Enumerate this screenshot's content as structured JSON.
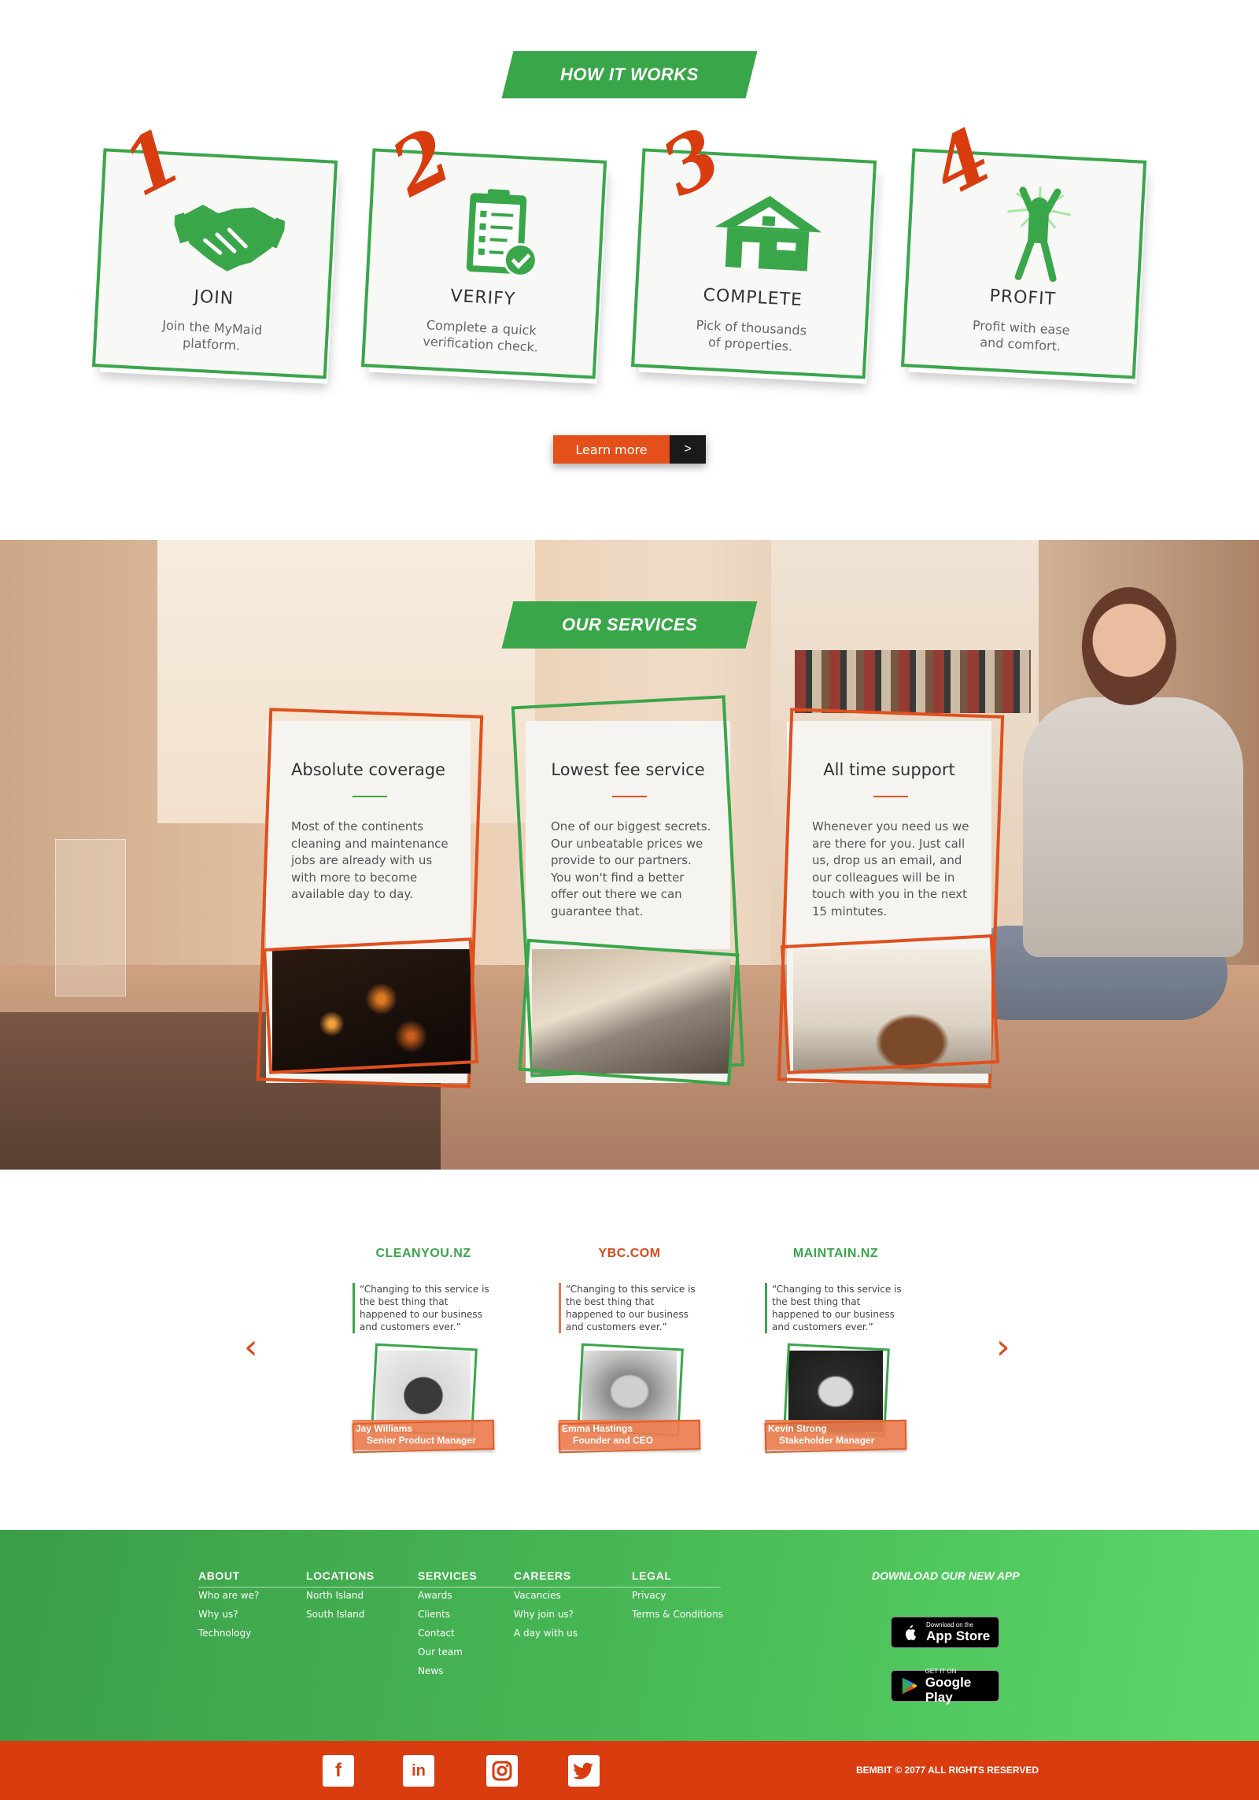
{
  "how": {
    "tag": "HOW IT WORKS",
    "steps": [
      {
        "num": "1",
        "title": "JOIN",
        "desc_line1": "Join the MyMaid",
        "desc_line2": "platform.",
        "icon": "handshake-icon"
      },
      {
        "num": "2",
        "title": "VERIFY",
        "desc_line1": "Complete a quick",
        "desc_line2": "verification check.",
        "icon": "clipboard-check-icon"
      },
      {
        "num": "3",
        "title": "COMPLETE",
        "desc_line1": "Pick of thousands",
        "desc_line2": "of properties.",
        "icon": "house-icon"
      },
      {
        "num": "4",
        "title": "PROFIT",
        "desc_line1": "Profit with ease",
        "desc_line2": "and comfort.",
        "icon": "celebrate-person-icon"
      }
    ],
    "learn_more": "Learn more",
    "learn_arrow": ">"
  },
  "services": {
    "tag": "OUR SERVICES",
    "cards": [
      {
        "title": "Absolute coverage",
        "text": "Most of the continents cleaning and maintenance jobs are already with us with more to become available day to day."
      },
      {
        "title": "Lowest fee service",
        "text": "One of our biggest secrets. Our unbeatable prices we provide to our partners. You won't find a better offer out there we can guarantee that."
      },
      {
        "title": "All time support",
        "text": "Whenever you need us we are there for you. Just call us, drop us an email, and our colleagues will be in touch with you in the next 15 mintutes."
      }
    ]
  },
  "testimonials": {
    "items": [
      {
        "company": "CLEANYOU.NZ",
        "quote": "“Changing to this service is the best thing that happened to our business and customers ever.”",
        "name": "Jay Williams",
        "role": "Senior Product Manager",
        "color": "#3aa64a"
      },
      {
        "company": "YBC.COM",
        "quote": "“Changing to this service is the best thing that happened to our business and customers ever.”",
        "name": "Emma Hastings",
        "role": "Founder and CEO",
        "color": "#d94a1a"
      },
      {
        "company": "MAINTAIN.NZ",
        "quote": "“Changing to this service is the best thing that happened to our business and customers ever.”",
        "name": "Kevin Strong",
        "role": "Stakeholder Manager",
        "color": "#3aa64a"
      }
    ],
    "prev": "‹",
    "next": "›"
  },
  "footer": {
    "columns": [
      {
        "heading": "ABOUT",
        "items": [
          "Who are we?",
          "Why us?",
          "Technology"
        ]
      },
      {
        "heading": "LOCATIONS",
        "items": [
          "North Island",
          "South Island"
        ]
      },
      {
        "heading": "SERVICES",
        "items": [
          "Awards",
          "Clients",
          "Contact",
          "Our team",
          "News"
        ]
      },
      {
        "heading": "CAREERS",
        "items": [
          "Vacancies",
          "Why join us?",
          "A day with us"
        ]
      },
      {
        "heading": "LEGAL",
        "items": [
          "Privacy",
          "Terms & Conditions"
        ]
      }
    ],
    "app_title": "DOWNLOAD OUR NEW APP",
    "appstore_small": "Download on the",
    "appstore_big": "App Store",
    "gplay_small": "GET IT ON",
    "gplay_big": "Google Play",
    "copyright": "BEMBIT © 2077 ALL RIGHTS RESERVED",
    "social": [
      "facebook-icon",
      "linkedin-icon",
      "instagram-icon",
      "twitter-icon"
    ]
  },
  "colors": {
    "green": "#3aa64a",
    "orange": "#d93c0e",
    "button_orange": "#e5501a"
  }
}
